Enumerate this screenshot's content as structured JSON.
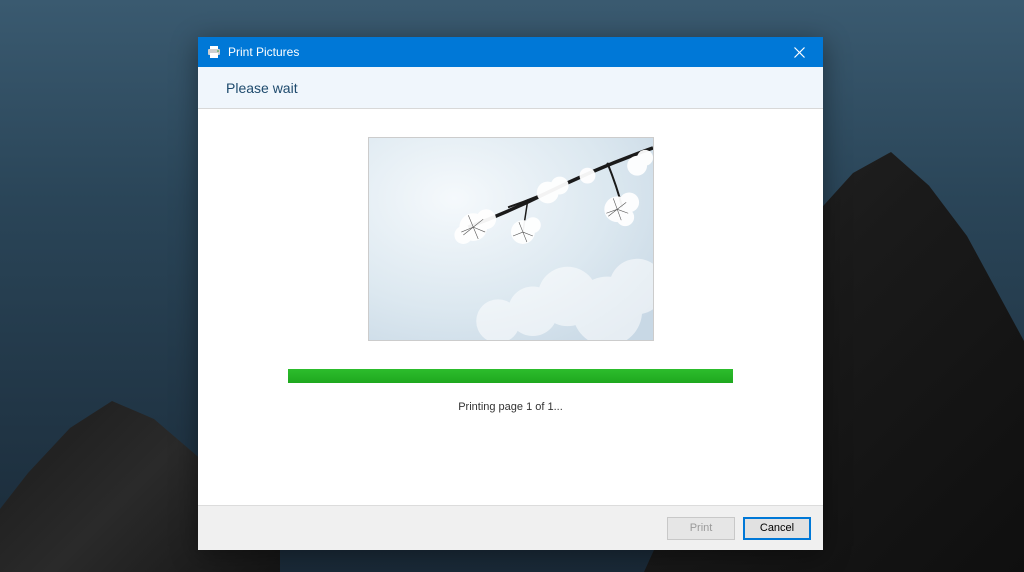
{
  "dialog": {
    "title": "Print Pictures",
    "subtitle": "Please wait",
    "status": "Printing page 1 of 1...",
    "progress_percent": 100,
    "buttons": {
      "print": "Print",
      "cancel": "Cancel"
    },
    "colors": {
      "titlebar": "#0078d7",
      "progress": "#1ea81e"
    }
  }
}
